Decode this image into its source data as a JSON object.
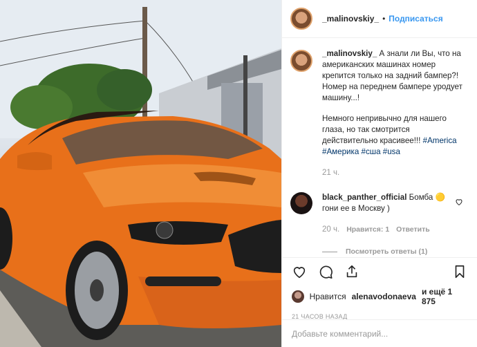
{
  "post": {
    "author": "_malinovskiy_",
    "follow_label": "Подписаться",
    "separator": "•"
  },
  "caption": {
    "author": "_malinovskiy_",
    "text_1": "А знали ли Вы, что на американских машинах номер крепится только на задний бампер?! Номер на переднем бампере уродует машину...!",
    "text_2": "Немного непривычно для нашего глаза, но так смотрится действительно красивее!!!",
    "tags": [
      "#America",
      "#Америка",
      "#сша",
      "#usa"
    ],
    "time": "21 ч."
  },
  "comment": {
    "author": "black_panther_official",
    "text": "Бомба 🟡 гони ее в Москву )",
    "time": "20 ч.",
    "likes": "Нравится: 1",
    "reply": "Ответить",
    "view_replies": "Посмотреть ответы (1)"
  },
  "likes": {
    "prefix": "Нравится",
    "user": "alenavodonaeva",
    "suffix": "и ещё 1 875"
  },
  "timestamp": "21 ЧАСОВ НАЗАД",
  "add_comment": {
    "placeholder": "Добавьте комментарий..."
  },
  "icons": {
    "like": "heart-icon",
    "comment": "comment-icon",
    "share": "share-icon",
    "save": "bookmark-icon",
    "comment_like": "heart-icon"
  },
  "colors": {
    "link": "#3897f0",
    "tag": "#003569",
    "car": "#e8701a"
  }
}
